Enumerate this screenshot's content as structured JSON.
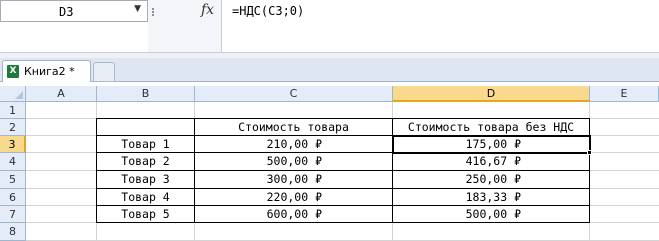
{
  "formula_bar": {
    "name_box": "D3",
    "fx_icon": "fx-icon",
    "formula": "=НДС(C3;0)"
  },
  "workbook": {
    "tab_label": "Книга2 *",
    "icon": "excel-workbook-icon"
  },
  "grid": {
    "columns": [
      "A",
      "B",
      "C",
      "D",
      "E"
    ],
    "rows": [
      "1",
      "2",
      "3",
      "4",
      "5",
      "6",
      "7",
      "8"
    ],
    "selected_column": "D",
    "selected_row": "3",
    "header_c": "Стоимость товара",
    "header_d": "Стоимость товара без НДС",
    "table": [
      {
        "name": "Товар 1",
        "price": "210,00 ₽",
        "price_net": "175,00 ₽"
      },
      {
        "name": "Товар 2",
        "price": "500,00 ₽",
        "price_net": "416,67 ₽"
      },
      {
        "name": "Товар 3",
        "price": "300,00 ₽",
        "price_net": "250,00 ₽"
      },
      {
        "name": "Товар 4",
        "price": "220,00 ₽",
        "price_net": "183,33 ₽"
      },
      {
        "name": "Товар 5",
        "price": "600,00 ₽",
        "price_net": "500,00 ₽"
      }
    ]
  }
}
